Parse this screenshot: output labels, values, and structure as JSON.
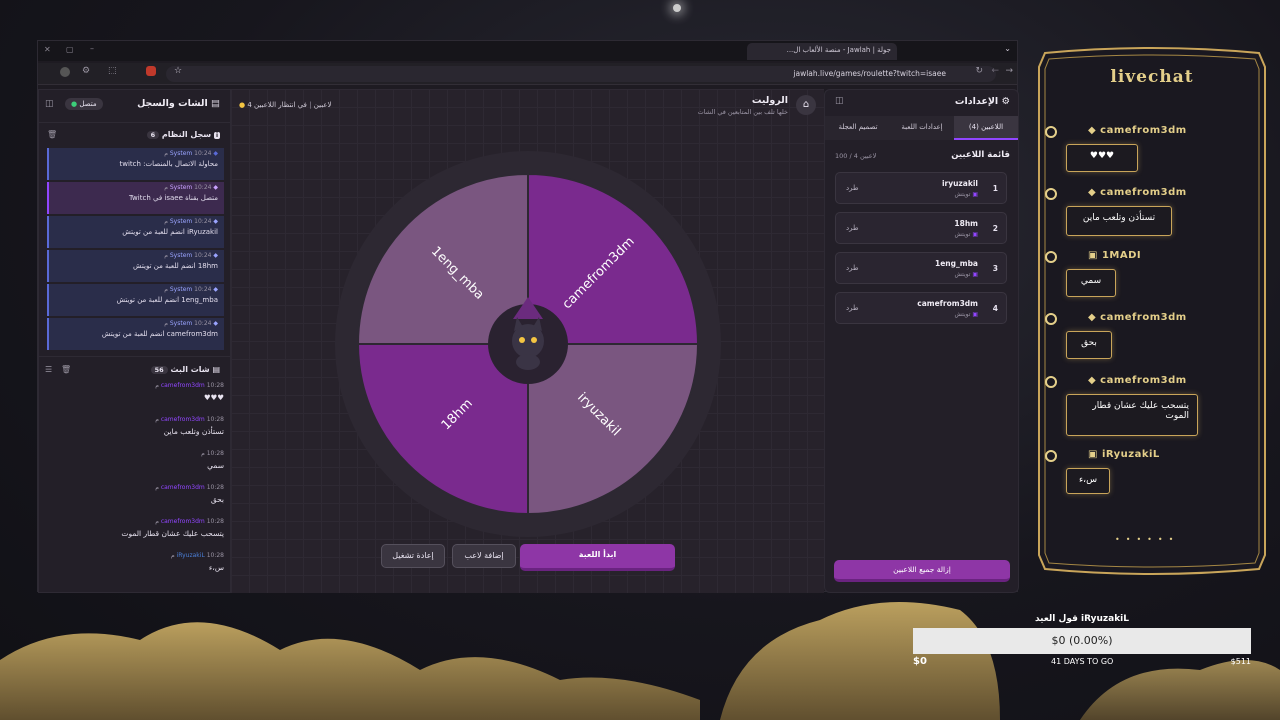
{
  "browser": {
    "tab_title": "جولة | Jawlah - منصة الألعاب ال...",
    "url": "jawlah.live/games/roulette?twitch=isaee"
  },
  "left_panel": {
    "title": "الشات والسجل",
    "status": "متصل",
    "system_log": {
      "title": "سجل النظام",
      "count": "6",
      "items": [
        {
          "user": "System",
          "time": "10:24 م",
          "msg": "محاولة الاتصال بالمنصات: twitch",
          "kind": "system"
        },
        {
          "user": "System",
          "time": "10:24 م",
          "msg": "متصل بقناة isaee في Twitch",
          "kind": "twitch"
        },
        {
          "user": "System",
          "time": "10:24 م",
          "msg": "iRyuzakil انضم للعبة من تويتش",
          "kind": "system"
        },
        {
          "user": "System",
          "time": "10:24 م",
          "msg": "18hm انضم للعبة من تويتش",
          "kind": "system"
        },
        {
          "user": "System",
          "time": "10:24 م",
          "msg": "1eng_mba انضم للعبة من تويتش",
          "kind": "system"
        },
        {
          "user": "System",
          "time": "10:24 م",
          "msg": "camefrom3dm انضم للعبة من تويتش",
          "kind": "system"
        }
      ]
    },
    "stream_chat": {
      "title": "شات البث",
      "count": "56",
      "items": [
        {
          "user": "camefrom3dm",
          "time": "10:28 م",
          "msg": "♥♥♥"
        },
        {
          "user": "camefrom3dm",
          "time": "10:28 م",
          "msg": "تستأذن وتلعب ماين"
        },
        {
          "user": "",
          "time": "10:28 م",
          "msg": "سمي"
        },
        {
          "user": "camefrom3dm",
          "time": "10:28 م",
          "msg": "بحق"
        },
        {
          "user": "camefrom3dm",
          "time": "10:28 م",
          "msg": "يتسحب عليك عشان قطار الموت"
        },
        {
          "user": "iRyuzakiL",
          "time": "10:28 م",
          "msg": "س،ء"
        }
      ]
    }
  },
  "center": {
    "title": "الروليت",
    "subtitle": "خلها تلف بين المتابعين في الشات",
    "players_count": "4 لاعبين",
    "waiting": "في انتظار اللاعبين",
    "wheel": {
      "segments": [
        {
          "label": "camefrom3dm",
          "color": "#7a2a8e"
        },
        {
          "label": "iryuzakil",
          "color": "#7a5680"
        },
        {
          "label": "18hm",
          "color": "#7a2a8e"
        },
        {
          "label": "1eng_mba",
          "color": "#7a5680"
        }
      ]
    },
    "buttons": {
      "start": "ابدأ اللعبة",
      "add_player": "إضافة لاعب",
      "restart": "إعادة تشغيل"
    }
  },
  "right_panel": {
    "title": "الإعدادات",
    "tabs": [
      "اللاعبين (4)",
      "إعدادات اللعبة",
      "تصميم العجلة"
    ],
    "list_title": "قائمة اللاعبين",
    "list_count": "100 / 4 لاعبين",
    "players": [
      {
        "num": "1",
        "name": "iryuzakil",
        "source": "تويتش",
        "kick": "طرد"
      },
      {
        "num": "2",
        "name": "18hm",
        "source": "تويتش",
        "kick": "طرد"
      },
      {
        "num": "3",
        "name": "1eng_mba",
        "source": "تويتش",
        "kick": "طرد"
      },
      {
        "num": "4",
        "name": "camefrom3dm",
        "source": "تويتش",
        "kick": "طرد"
      }
    ],
    "remove_all": "إزالة جميع اللاعبين"
  },
  "livechat": {
    "title": "livechat",
    "messages": [
      {
        "user": "camefrom3dm",
        "msg": "♥♥♥"
      },
      {
        "user": "camefrom3dm",
        "msg": "تستأذن وتلعب ماين"
      },
      {
        "user": "1MADI",
        "msg": "سمي"
      },
      {
        "user": "camefrom3dm",
        "msg": "بحق"
      },
      {
        "user": "camefrom3dm",
        "msg": "يتسحب عليك عشان قطار الموت"
      },
      {
        "user": "iRyuzakiL",
        "msg": "س،ء"
      }
    ]
  },
  "goal": {
    "title": "iRyuzakiL قول العيد",
    "amount": "$0 (0.00%)",
    "min": "$0",
    "days": "41 DAYS TO GO",
    "max": "$511",
    "progress": 0
  }
}
